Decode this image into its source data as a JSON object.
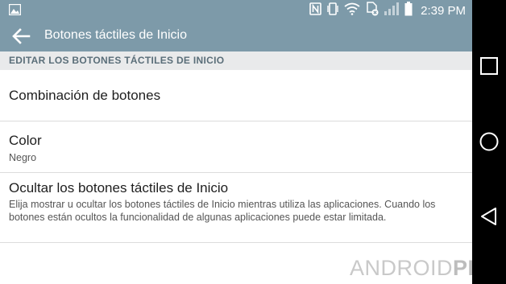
{
  "status_bar": {
    "time": "2:39 PM",
    "icons": [
      "image-icon",
      "nfc-icon",
      "vibrate-icon",
      "wifi-icon",
      "sim-no-icon",
      "signal-icon",
      "battery-icon"
    ]
  },
  "app_bar": {
    "back_icon": "arrow-left-icon",
    "title": "Botones táctiles de Inicio"
  },
  "section_header": "EDITAR LOS BOTONES TÁCTILES DE INICIO",
  "settings": [
    {
      "title": "Combinación de botones"
    },
    {
      "title": "Color",
      "summary": "Negro"
    },
    {
      "title": "Ocultar los botones táctiles de Inicio",
      "summary": "Elija mostrar u ocultar los botones táctiles de Inicio mientras utiliza las aplicaciones. Cuando los botones están ocultos la funcionalidad de algunas aplicaciones puede estar limitada."
    }
  ],
  "nav_bar": {
    "buttons": [
      "recent-apps-icon",
      "home-icon",
      "back-triangle-icon"
    ]
  },
  "watermark": {
    "part1": "ANDROID",
    "part2": "PIT"
  },
  "colors": {
    "bar": "#7d9aa9",
    "section_bg": "#e9eaeb",
    "section_text": "#5a6e79",
    "nav_bg": "#000000"
  }
}
